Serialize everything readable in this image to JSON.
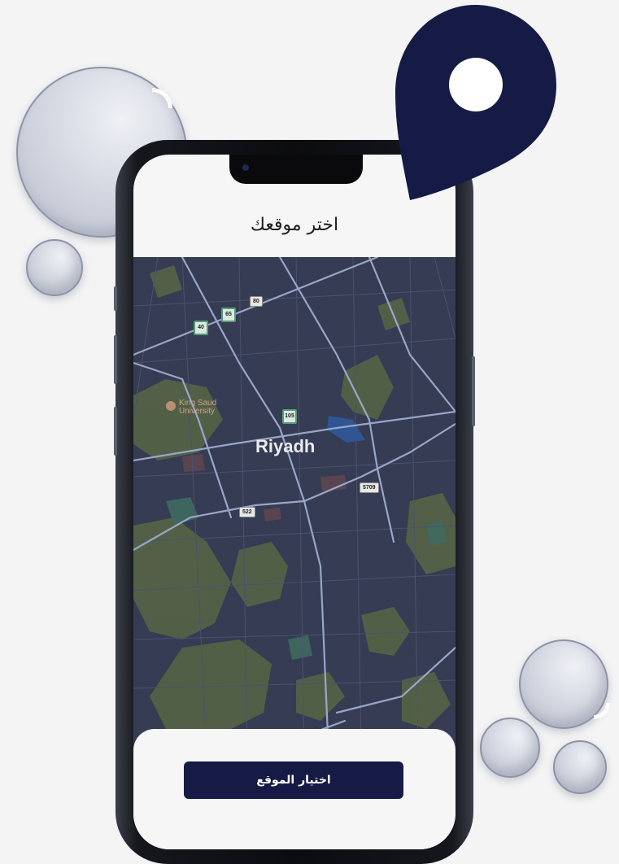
{
  "header": {
    "title": "اختر موقعك"
  },
  "map": {
    "city_label": "Riyadh",
    "poi": {
      "name_line1": "King Saud",
      "name_line2": "University"
    },
    "route_shields": [
      "40",
      "65",
      "80",
      "105",
      "522",
      "5709"
    ]
  },
  "footer": {
    "select_button_label": "اختيار الموقع"
  },
  "colors": {
    "primary": "#151b45",
    "map_background": "#353c53"
  }
}
